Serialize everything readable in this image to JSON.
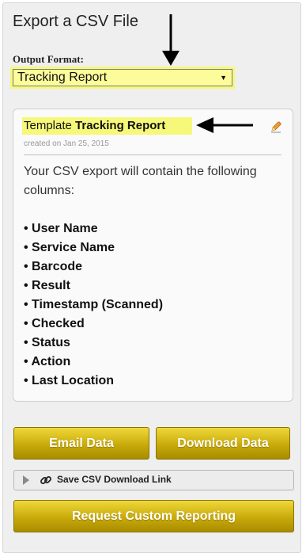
{
  "page": {
    "title": "Export a CSV File"
  },
  "output_format": {
    "label": "Output Format:",
    "selected": "Tracking Report"
  },
  "template": {
    "prefix": "Template",
    "name": "Tracking Report",
    "created": "created on Jan 25, 2015",
    "description": "Your CSV export will contain the following columns:",
    "columns": [
      "• User Name",
      "• Service Name",
      "• Barcode",
      "• Result",
      "• Timestamp (Scanned)",
      "• Checked",
      "• Status",
      "• Action",
      "• Last Location"
    ]
  },
  "actions": {
    "email_label": "Email Data",
    "download_label": "Download Data",
    "save_link_label": "Save CSV Download Link",
    "request_label": "Request Custom Reporting"
  },
  "icons": {
    "edit": "pencil-icon",
    "expand": "triangle-right-icon",
    "link": "chain-link-icon",
    "dropdown": "caret-down-icon"
  },
  "colors": {
    "highlight": "#f6f87a",
    "button_gold": "#c9aa0a",
    "panel_bg": "#efefef"
  }
}
